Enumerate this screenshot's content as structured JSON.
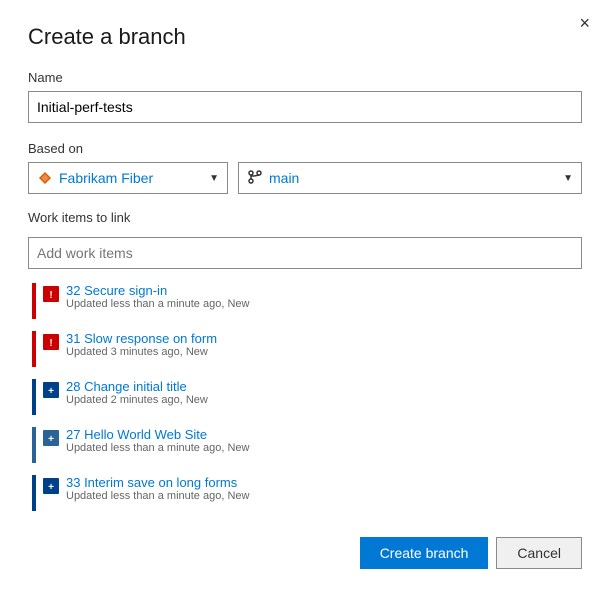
{
  "dialog": {
    "title": "Create a branch",
    "close_label": "×"
  },
  "name_field": {
    "label": "Name",
    "value": "Initial-perf-tests",
    "placeholder": ""
  },
  "based_on": {
    "label": "Based on",
    "repo": {
      "name": "Fabrikam Fiber",
      "color": "#e05a00"
    },
    "branch": {
      "name": "main"
    }
  },
  "work_items": {
    "label": "Work items to link",
    "placeholder": "Add work items",
    "items": [
      {
        "id": "32",
        "title": "Secure sign-in",
        "meta": "Updated less than a minute ago, New",
        "bar_color": "#cc0000",
        "icon_color": "#cc0000",
        "icon_type": "bug"
      },
      {
        "id": "31",
        "title": "Slow response on form",
        "meta": "Updated 3 minutes ago, New",
        "bar_color": "#cc0000",
        "icon_color": "#cc0000",
        "icon_type": "bug"
      },
      {
        "id": "28",
        "title": "Change initial title",
        "meta": "Updated 2 minutes ago, New",
        "bar_color": "#003f8a",
        "icon_color": "#003f8a",
        "icon_type": "task"
      },
      {
        "id": "27",
        "title": "Hello World Web Site",
        "meta": "Updated less than a minute ago, New",
        "bar_color": "#2a6496",
        "icon_color": "#2a6496",
        "icon_type": "task"
      },
      {
        "id": "33",
        "title": "Interim save on long forms",
        "meta": "Updated less than a minute ago, New",
        "bar_color": "#003f8a",
        "icon_color": "#003f8a",
        "icon_type": "task"
      }
    ]
  },
  "footer": {
    "create_label": "Create branch",
    "cancel_label": "Cancel"
  }
}
